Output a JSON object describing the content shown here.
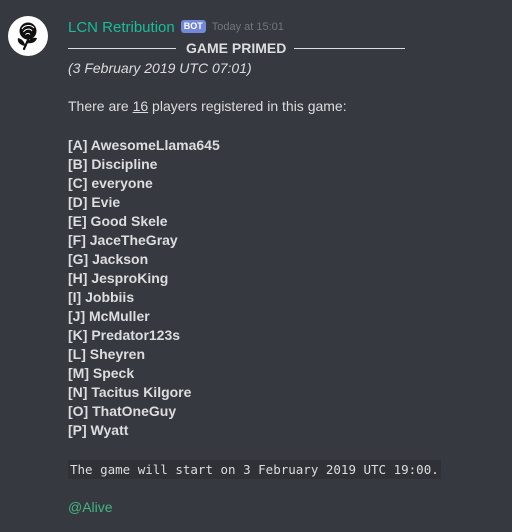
{
  "message": {
    "author": "LCN Retribution",
    "bot_tag": "BOT",
    "timestamp": "Today at 15:01",
    "avatar_icon": "black-rose-icon",
    "divider_title": "GAME PRIMED",
    "date_line": "(3 February 2019 UTC 07:01)",
    "registered_prefix": "There are ",
    "player_count": "16",
    "registered_suffix": " players registered in this game:",
    "players": [
      "[A] AwesomeLlama645",
      "[B] Discipline",
      "[C] everyone",
      "[D] Evie",
      "[E] Good Skele",
      "[F] JaceTheGray",
      "[G] Jackson",
      "[H] JesproKing",
      "[I] Jobbiis",
      "[J] McMuller",
      "[K] Predator123s",
      "[L] Sheyren",
      "[M] Speck",
      "[N] Tacitus Kilgore",
      "[O] ThatOneGuy",
      "[P] Wyatt"
    ],
    "start_line": "The game will start on 3 February 2019 UTC 19:00.",
    "mention": "@Alive"
  },
  "colors": {
    "background": "#36393f",
    "username": "#1abc9c",
    "bot_tag": "#7289da",
    "timestamp": "#72767d",
    "text": "#dcddde",
    "code_background": "#2f3136",
    "mention": "#43b581"
  }
}
